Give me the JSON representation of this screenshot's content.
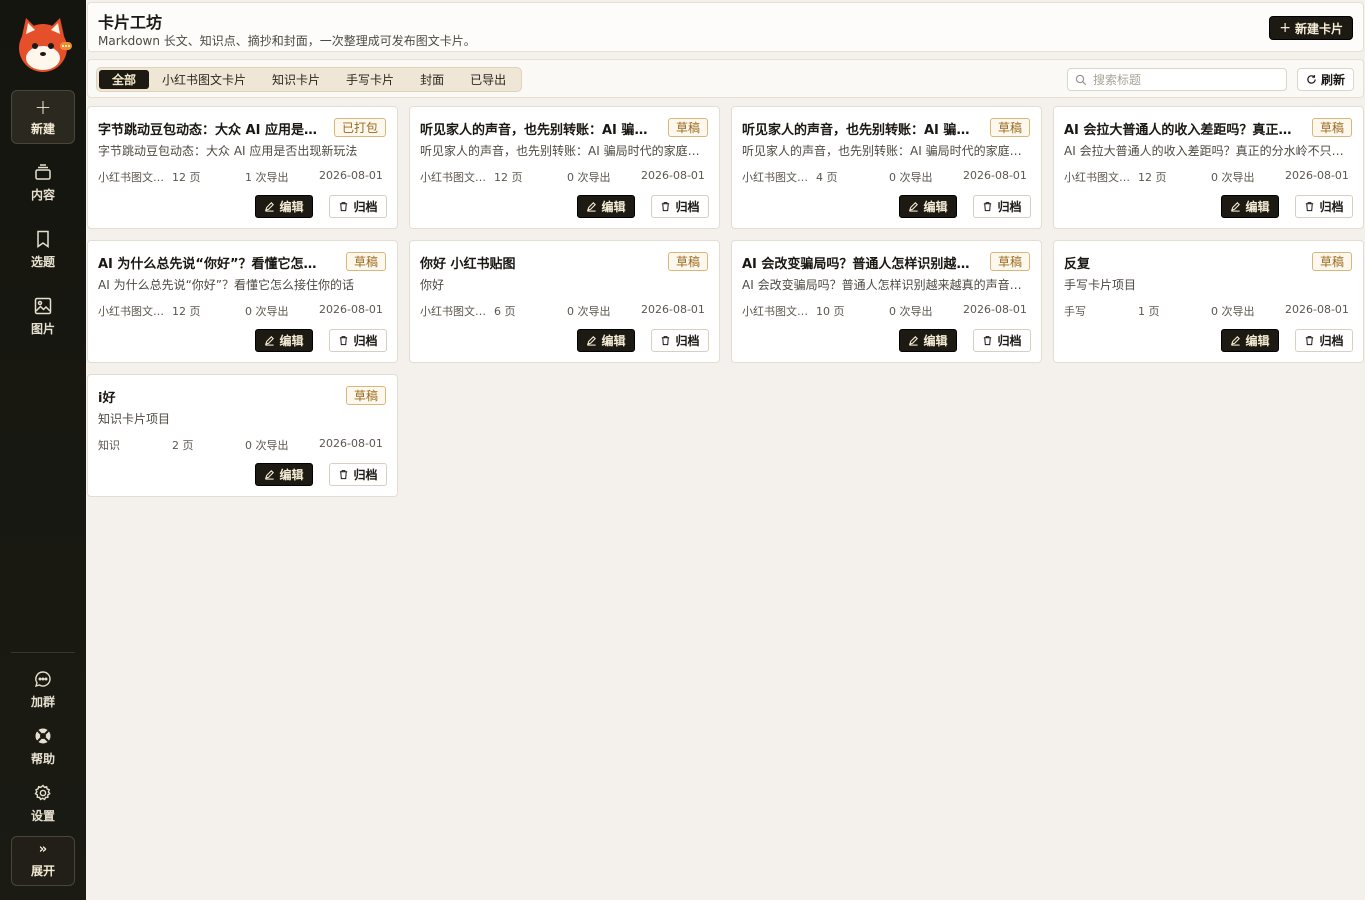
{
  "sidebar": {
    "new_label": "新建",
    "items": [
      {
        "label": "内容",
        "icon": "stack-icon"
      },
      {
        "label": "选题",
        "icon": "bookmark-icon"
      },
      {
        "label": "图片",
        "icon": "image-icon"
      }
    ],
    "bottom": [
      {
        "label": "加群",
        "icon": "chat-icon"
      },
      {
        "label": "帮助",
        "icon": "help-icon"
      },
      {
        "label": "设置",
        "icon": "gear-icon"
      }
    ],
    "expand_label": "展开",
    "expand_glyph": "»"
  },
  "header": {
    "title": "卡片工坊",
    "subtitle": "Markdown 长文、知识点、摘抄和封面，一次整理成可发布图文卡片。",
    "new_card_label": "新建卡片"
  },
  "toolbar": {
    "tabs": [
      "全部",
      "小红书图文卡片",
      "知识卡片",
      "手写卡片",
      "封面",
      "已导出"
    ],
    "active_tab": 0,
    "search_placeholder": "搜索标题",
    "refresh_label": "刷新"
  },
  "card_actions": {
    "edit_label": "编辑",
    "archive_label": "归档"
  },
  "cards": [
    {
      "title": "字节跳动豆包动态：大众 AI 应用是否出现新玩法",
      "desc": "字节跳动豆包动态：大众 AI 应用是否出现新玩法",
      "badge": "已打包",
      "type": "小红书图文卡片",
      "pages": "12 页",
      "exports": "1 次导出",
      "date": "2026-08-01"
    },
    {
      "title": "听见家人的声音，也先别转账：AI 骗局时代的家庭防线",
      "desc": "听见家人的声音，也先别转账：AI 骗局时代的家庭防线",
      "badge": "草稿",
      "type": "小红书图文卡片",
      "pages": "12 页",
      "exports": "0 次导出",
      "date": "2026-08-01"
    },
    {
      "title": "听见家人的声音，也先别转账：AI 骗局时代的家庭防线",
      "desc": "听见家人的声音，也先别转账：AI 骗局时代的家庭防线",
      "badge": "草稿",
      "type": "小红书图文卡片",
      "pages": "4 页",
      "exports": "0 次导出",
      "date": "2026-08-01"
    },
    {
      "title": "AI 会拉大普通人的收入差距吗？真正的分水岭不只是工具",
      "desc": "AI 会拉大普通人的收入差距吗？真正的分水岭不只是工具",
      "badge": "草稿",
      "type": "小红书图文卡片",
      "pages": "12 页",
      "exports": "0 次导出",
      "date": "2026-08-01"
    },
    {
      "title": "AI 为什么总先说“你好”？看懂它怎么接住你的话",
      "desc": "AI 为什么总先说“你好”？看懂它怎么接住你的话",
      "badge": "草稿",
      "type": "小红书图文卡片",
      "pages": "12 页",
      "exports": "0 次导出",
      "date": "2026-08-01"
    },
    {
      "title": "你好 小红书贴图",
      "desc": "你好",
      "badge": "草稿",
      "type": "小红书图文卡片",
      "pages": "6 页",
      "exports": "0 次导出",
      "date": "2026-08-01"
    },
    {
      "title": "AI 会改变骗局吗？普通人怎样识别越来越真的声音",
      "desc": "AI 会改变骗局吗？普通人怎样识别越来越真的声音和视频",
      "badge": "草稿",
      "type": "小红书图文卡片",
      "pages": "10 页",
      "exports": "0 次导出",
      "date": "2026-08-01"
    },
    {
      "title": "反复",
      "desc": "手写卡片项目",
      "badge": "草稿",
      "type": "手写",
      "pages": "1 页",
      "exports": "0 次导出",
      "date": "2026-08-01"
    },
    {
      "title": "i好",
      "desc": "知识卡片项目",
      "badge": "草稿",
      "type": "知识",
      "pages": "2 页",
      "exports": "0 次导出",
      "date": "2026-08-01"
    }
  ],
  "colors": {
    "sidebar_bg": "#15150f",
    "accent_dark": "#1d1a13",
    "badge_border": "#d9b77b",
    "badge_text": "#9b6a1e",
    "page_bg": "#f4f1ec"
  }
}
